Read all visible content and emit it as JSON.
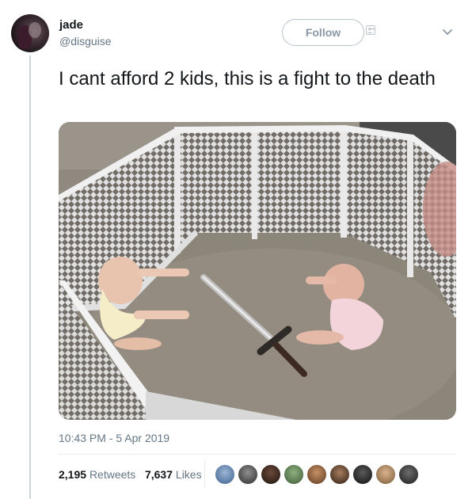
{
  "tweet": {
    "name": "jade",
    "handle": "@disguise",
    "follow_label": "Follow",
    "text": "I cant afford 2 kids, this is a fight to the death",
    "timestamp": "10:43 PM - 5 Apr 2019",
    "retweets_count": "2,195",
    "retweets_label": "Retweets",
    "likes_count": "7,637",
    "likes_label": "Likes"
  },
  "icons": {
    "follow_icon": "person-add-icon",
    "menu": "chevron-down-icon"
  },
  "colors": {
    "text": "#14171a",
    "secondary": "#657786",
    "border": "#e6ecf0"
  }
}
